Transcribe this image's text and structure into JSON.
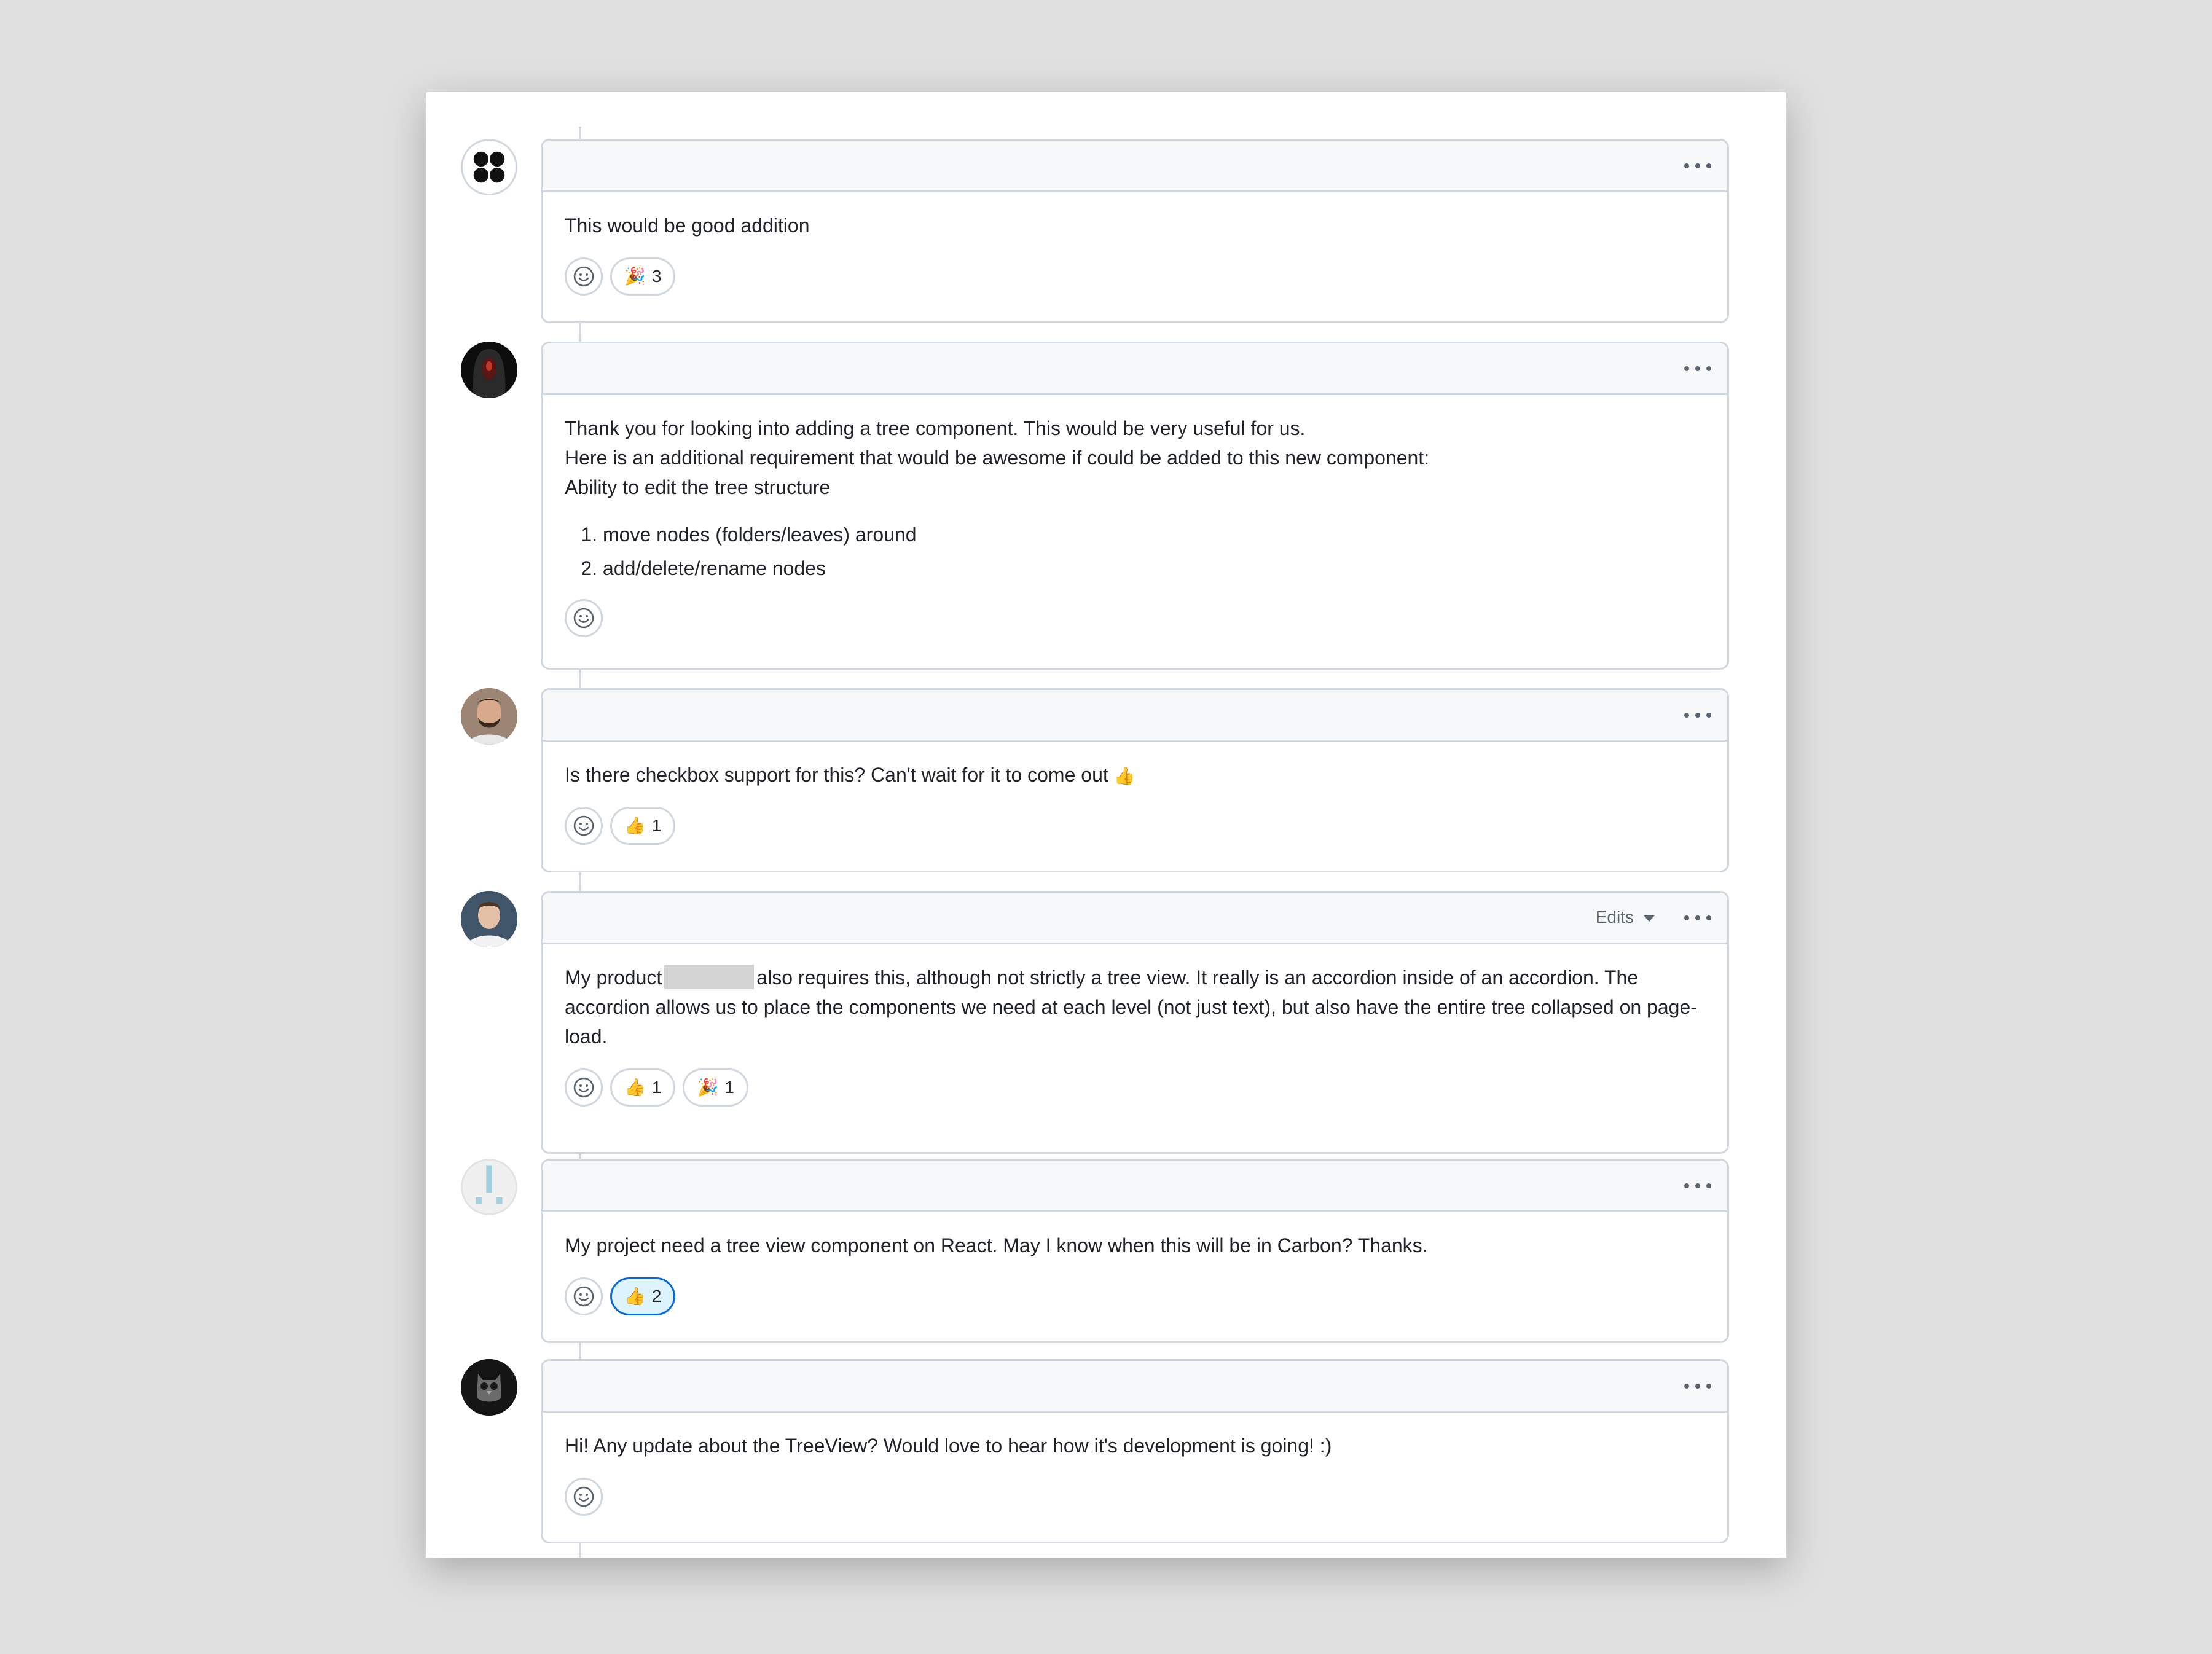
{
  "comments": [
    {
      "avatar": "dots-logo-avatar",
      "paragraphs": [
        "This would be good addition"
      ],
      "reactions": [
        {
          "emoji": "🎉",
          "icon": "tada-icon",
          "count": "3"
        }
      ]
    },
    {
      "avatar": "hooded-figure-avatar",
      "paragraphs": [
        "Thank you for looking into adding a tree component. This would be very useful for us.",
        "Here is an additional requirement that would be awesome if could be added to this new component:",
        "Ability to edit the tree structure"
      ],
      "list": [
        "move nodes (folders/leaves) around",
        "add/delete/rename nodes"
      ],
      "reactions": []
    },
    {
      "avatar": "bearded-man-avatar",
      "text": "Is there checkbox support for this? Can't wait for it to come out",
      "text_emoji": "👍",
      "reactions": [
        {
          "emoji": "👍",
          "icon": "thumbs-up-icon",
          "count": "1"
        }
      ]
    },
    {
      "avatar": "man-photo-avatar",
      "edits_label": "Edits",
      "text_before": "My product",
      "text_after": "also requires this, although not strictly a tree view. It really is an accordion inside of an accordion. The accordion allows us to place the components we need at each level (not just text), but also have the entire tree collapsed on page-load.",
      "reactions": [
        {
          "emoji": "👍",
          "icon": "thumbs-up-icon",
          "count": "1"
        },
        {
          "emoji": "🎉",
          "icon": "tada-icon",
          "count": "1"
        }
      ]
    },
    {
      "avatar": "exclamation-identicon-avatar",
      "paragraphs": [
        "My project need a tree view component on React. May I know when this will be in Carbon? Thanks."
      ],
      "reactions": [
        {
          "emoji": "👍",
          "icon": "thumbs-up-icon",
          "count": "2",
          "active": true
        }
      ]
    },
    {
      "avatar": "owl-avatar",
      "paragraphs": [
        "Hi! Any update about the TreeView? Would love to hear how it's development is going! :)"
      ],
      "reactions": []
    }
  ],
  "colors": {
    "border": "#d0d7de",
    "header_bg": "#f6f8fa",
    "active_reaction_bg": "#ddf4ff",
    "active_reaction_border": "#0969da"
  }
}
